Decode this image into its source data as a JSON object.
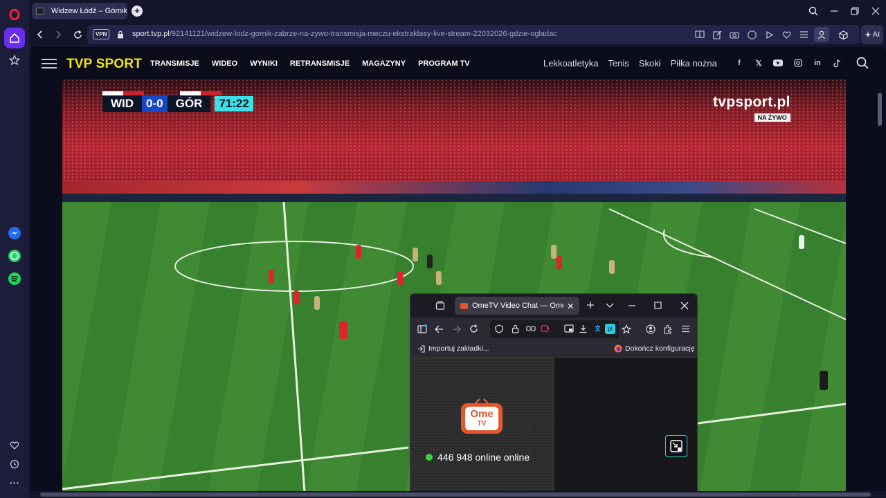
{
  "browser": {
    "tab": {
      "title": "Widzew Łódź – Górnik",
      "favicon": "tvp-favicon"
    },
    "new_tab_label": "+",
    "address": {
      "vpn_label": "VPN",
      "url_host": "sport.tvp.pl",
      "url_path": "/92141121/widzew-lodz-gornik-zabrze-na-zywo-transmisja-meczu-ekstraklasy-live-stream-22032026-gdzie-ogladac"
    },
    "ai_label": "AI",
    "sidebar": [
      "opera-logo-icon",
      "home-icon",
      "bookmarks-star-icon",
      "messenger-icon",
      "whatsapp-icon",
      "spotify-icon",
      "heart-icon",
      "history-icon",
      "more-icon"
    ]
  },
  "site": {
    "logo": "TVP SPORT",
    "main_nav": [
      "TRANSMISJE",
      "WIDEO",
      "WYNIKI",
      "RETRANSMISJE",
      "MAGAZYNY",
      "PROGRAM TV"
    ],
    "sport_nav": [
      "Lekkoatletyka",
      "Tenis",
      "Skoki",
      "Piłka nożna"
    ],
    "social": [
      "facebook-icon",
      "x-icon",
      "youtube-icon",
      "instagram-icon",
      "linkedin-icon",
      "tiktok-icon"
    ]
  },
  "video": {
    "scoreboard": {
      "home": "WID",
      "score": "0-0",
      "away": "GÓR",
      "time": "71:22"
    },
    "watermark": "tvpsport.pl",
    "live_badge": "NA ŻYWO"
  },
  "popup": {
    "tab_title": "OmeTV Video Chat — Omegle Al",
    "bookmark_import": "Importuj zakładki...",
    "finish_setup": "Dokończ konfigurację",
    "translate_badge": "pl",
    "logo_top": "Ome",
    "logo_bottom": "TV",
    "online_count": "446 948 online online"
  },
  "colors": {
    "opera_red": "#ff1b2d",
    "tvp_yellow": "#f2e600",
    "score_blue": "#1846c8",
    "time_cyan": "#39e0e8",
    "online_green": "#3ad53a",
    "ome_orange": "#e2572b"
  }
}
